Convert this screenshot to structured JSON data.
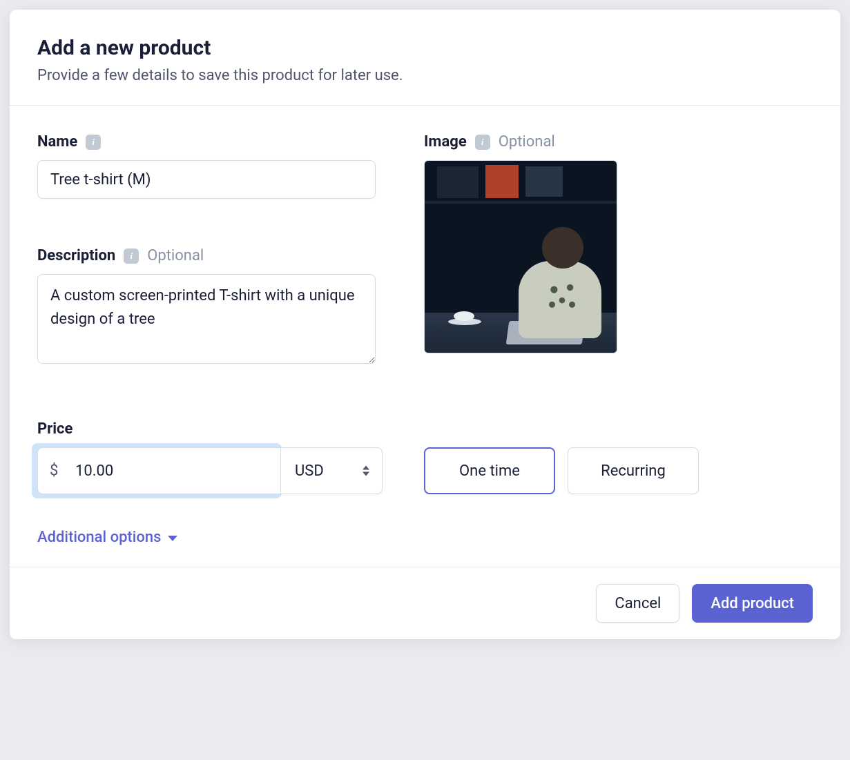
{
  "modal": {
    "title": "Add a new product",
    "subtitle": "Provide a few details to save this product for later use."
  },
  "fields": {
    "name": {
      "label": "Name",
      "value": "Tree t-shirt (M)"
    },
    "description": {
      "label": "Description",
      "optional": "Optional",
      "value": "A custom screen-printed T-shirt with a unique design of a tree"
    },
    "image": {
      "label": "Image",
      "optional": "Optional"
    },
    "price": {
      "label": "Price",
      "symbol": "$",
      "amount": "10.00",
      "currency": "USD",
      "billing": {
        "one_time": "One time",
        "recurring": "Recurring",
        "selected": "one_time"
      }
    }
  },
  "links": {
    "additional_options": "Additional options"
  },
  "footer": {
    "cancel": "Cancel",
    "submit": "Add product"
  }
}
